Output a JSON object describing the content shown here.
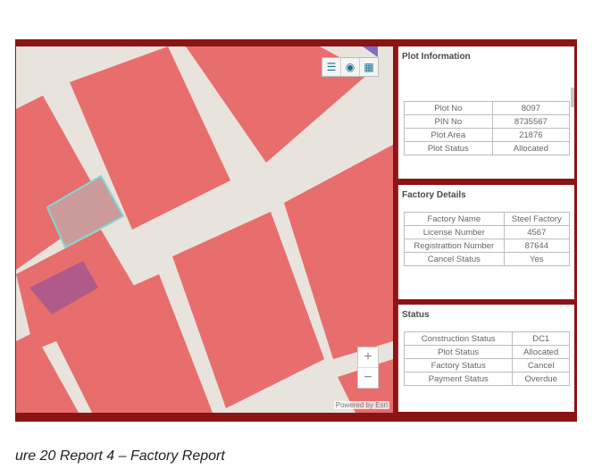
{
  "colors": {
    "frame": "#8b1414",
    "parcel": "#e86e6e",
    "road": "#e9e3dd",
    "highlight": "#b05a8a"
  },
  "map": {
    "attribution": "Powered by Esri",
    "zoom_in": "+",
    "zoom_out": "−"
  },
  "toolbar": {
    "icons": [
      "legend-icon",
      "layers-icon",
      "basemap-gallery-icon"
    ]
  },
  "plot_info": {
    "title": "Plot Information",
    "rows": [
      {
        "label": "Plot No",
        "value": "8097"
      },
      {
        "label": "PIN No",
        "value": "8735567"
      },
      {
        "label": "Plot Area",
        "value": "21876"
      },
      {
        "label": "Plot Status",
        "value": "Allocated"
      }
    ]
  },
  "factory": {
    "title": "Factory Details",
    "rows": [
      {
        "label": "Factory Name",
        "value": "Steel Factory"
      },
      {
        "label": "License Number",
        "value": "4567"
      },
      {
        "label": "Registrattion Number",
        "value": "87644"
      },
      {
        "label": "Cancel Status",
        "value": "Yes"
      }
    ]
  },
  "status": {
    "title": "Status",
    "rows": [
      {
        "label": "Construction Status",
        "value": "DC1"
      },
      {
        "label": "Plot Status",
        "value": "Allocated"
      },
      {
        "label": "Factory Status",
        "value": "Cancel"
      },
      {
        "label": "Payment Status",
        "value": "Overdue"
      }
    ]
  },
  "caption": "ure 20 Report 4 – Factory Report"
}
